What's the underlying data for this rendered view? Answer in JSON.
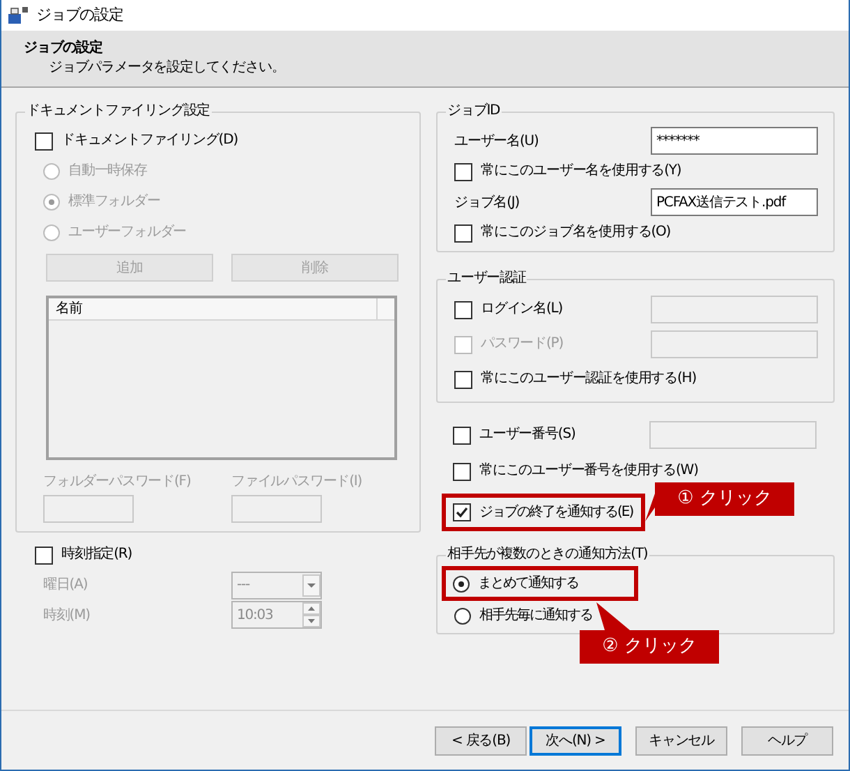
{
  "window": {
    "title": "ジョブの設定"
  },
  "header": {
    "title": "ジョブの設定",
    "subtitle": "ジョブパラメータを設定してください。"
  },
  "document_filing": {
    "title": "ドキュメントファイリング設定",
    "checkbox": {
      "label": "ドキュメントファイリング(D)",
      "checked": false
    },
    "radios": [
      {
        "label": "自動一時保存",
        "selected": false,
        "disabled": true
      },
      {
        "label": "標準フォルダー",
        "selected": true,
        "disabled": true
      },
      {
        "label": "ユーザーフォルダー",
        "selected": false,
        "disabled": true
      }
    ],
    "buttons": [
      {
        "label": "追加",
        "disabled": true
      },
      {
        "label": "削除",
        "disabled": true
      }
    ],
    "list": {
      "columns": [
        "名前"
      ]
    },
    "password_fields": [
      {
        "label": "フォルダーパスワード(F)",
        "disabled": true
      },
      {
        "label": "ファイルパスワード(I)",
        "disabled": true
      }
    ]
  },
  "schedule": {
    "checkbox": {
      "label": "時刻指定(R)",
      "checked": false
    },
    "day": {
      "label": "曜日(A)",
      "value": "---",
      "disabled": true
    },
    "time": {
      "label": "時刻(M)",
      "value": "10:03",
      "disabled": true
    }
  },
  "job_id": {
    "title": "ジョブID",
    "rows": [
      {
        "kind": "field",
        "label": "ユーザー名(U)",
        "value": "*******"
      },
      {
        "kind": "checkbox",
        "label": "常にこのユーザー名を使用する(Y)",
        "checked": false
      },
      {
        "kind": "field",
        "label": "ジョブ名(J)",
        "value": "PCFAX送信テスト.pdf"
      },
      {
        "kind": "checkbox",
        "label": "常にこのジョブ名を使用する(O)",
        "checked": false
      }
    ]
  },
  "user_auth": {
    "title": "ユーザー認証",
    "rows": [
      {
        "kind": "checkbox_field",
        "label": "ログイン名(L)",
        "checked": false,
        "disabled": false
      },
      {
        "kind": "checkbox_field",
        "label": "パスワード(P)",
        "checked": false,
        "disabled": true
      },
      {
        "kind": "checkbox",
        "label": "常にこのユーザー認証を使用する(H)",
        "checked": false,
        "disabled": false
      }
    ]
  },
  "user_number": {
    "rows": [
      {
        "kind": "checkbox_field",
        "label": "ユーザー番号(S)",
        "checked": false,
        "disabled": false
      },
      {
        "kind": "checkbox",
        "label": "常にこのユーザー番号を使用する(W)",
        "checked": false,
        "disabled": false
      }
    ]
  },
  "notify_end": {
    "label": "ジョブの終了を通知する(E)",
    "checked": true
  },
  "notify_method": {
    "title": "相手先が複数のときの通知方法(T)",
    "options": [
      {
        "label": "まとめて通知する",
        "selected": true
      },
      {
        "label": "相手先毎に通知する",
        "selected": false
      }
    ]
  },
  "callouts": [
    {
      "text": "① クリック"
    },
    {
      "text": "② クリック"
    }
  ],
  "buttons": [
    {
      "label": "< 戻る(B)",
      "default": false
    },
    {
      "label": "次へ(N) >",
      "default": true
    },
    {
      "label": "キャンセル",
      "default": false
    },
    {
      "label": "ヘルプ",
      "default": false
    }
  ]
}
